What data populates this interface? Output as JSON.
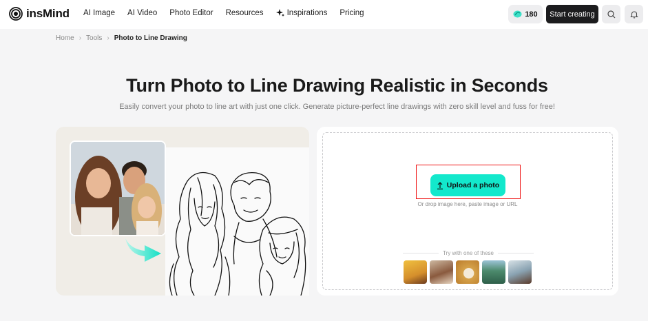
{
  "header": {
    "logo_text": "insMind",
    "nav": [
      {
        "label": "AI Image"
      },
      {
        "label": "AI Video"
      },
      {
        "label": "Photo Editor"
      },
      {
        "label": "Resources"
      },
      {
        "label": "Inspirations"
      },
      {
        "label": "Pricing"
      }
    ],
    "credits": "180",
    "start_label": "Start creating"
  },
  "breadcrumb": {
    "home": "Home",
    "tools": "Tools",
    "current": "Photo to Line Drawing"
  },
  "hero": {
    "title": "Turn Photo to Line Drawing Realistic in Seconds",
    "subtitle": "Easily convert your photo to line art with just one click. Generate picture-perfect line drawings with zero skill level and fuss for free!"
  },
  "upload": {
    "button_label": "Upload a photo",
    "hint": "Or drop image here, paste image or URL",
    "try_label": "Try with one of these",
    "samples": [
      {
        "name": "sample-woman-yellow",
        "color": "#e4a63a"
      },
      {
        "name": "sample-family",
        "color": "#b08a6e"
      },
      {
        "name": "sample-coffee-cup",
        "color": "#d9a84c"
      },
      {
        "name": "sample-landscape",
        "color": "#3d7a6a"
      },
      {
        "name": "sample-woman-portrait",
        "color": "#9fb3bf"
      }
    ]
  },
  "colors": {
    "accent": "#13e8cc",
    "dark_button": "#1c1c1e",
    "highlight": "#ee1111"
  }
}
